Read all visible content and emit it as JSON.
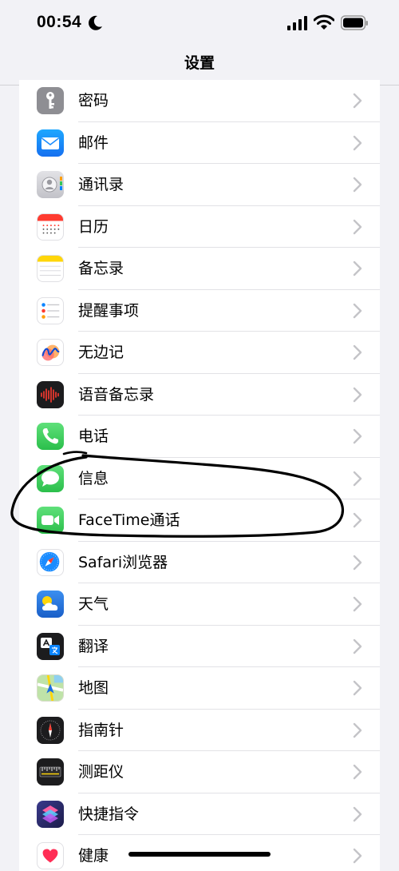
{
  "status_bar": {
    "time": "00:54",
    "moon_icon": "moon-icon",
    "signal_icon": "cellular-signal-icon",
    "wifi_icon": "wifi-icon",
    "battery_icon": "battery-icon"
  },
  "nav": {
    "title": "设置"
  },
  "settings_items": [
    {
      "label": "密码",
      "icon": "key-icon",
      "color": "#8e8e93"
    },
    {
      "label": "邮件",
      "icon": "mail-icon",
      "color": "#1a8cff"
    },
    {
      "label": "通讯录",
      "icon": "contacts-icon",
      "color": "#c7c7cc"
    },
    {
      "label": "日历",
      "icon": "calendar-icon",
      "color": "#ffffff"
    },
    {
      "label": "备忘录",
      "icon": "notes-icon",
      "color": "#ffffff"
    },
    {
      "label": "提醒事项",
      "icon": "reminders-icon",
      "color": "#ffffff"
    },
    {
      "label": "无边记",
      "icon": "freeform-icon",
      "color": "#ffffff"
    },
    {
      "label": "语音备忘录",
      "icon": "voice-memos-icon",
      "color": "#1c1c1e"
    },
    {
      "label": "电话",
      "icon": "phone-icon",
      "color": "#34c759"
    },
    {
      "label": "信息",
      "icon": "messages-icon",
      "color": "#34c759"
    },
    {
      "label": "FaceTime通话",
      "icon": "facetime-icon",
      "color": "#34c759"
    },
    {
      "label": "Safari浏览器",
      "icon": "safari-icon",
      "color": "#ffffff"
    },
    {
      "label": "天气",
      "icon": "weather-icon",
      "color": "#2b7fe0"
    },
    {
      "label": "翻译",
      "icon": "translate-icon",
      "color": "#1c1c1e"
    },
    {
      "label": "地图",
      "icon": "maps-icon",
      "color": "#7ed36a"
    },
    {
      "label": "指南针",
      "icon": "compass-icon",
      "color": "#1c1c1e"
    },
    {
      "label": "测距仪",
      "icon": "measure-icon",
      "color": "#1c1c1e"
    },
    {
      "label": "快捷指令",
      "icon": "shortcuts-icon",
      "color": "#5856d6"
    },
    {
      "label": "健康",
      "icon": "health-icon",
      "color": "#ffffff"
    }
  ]
}
